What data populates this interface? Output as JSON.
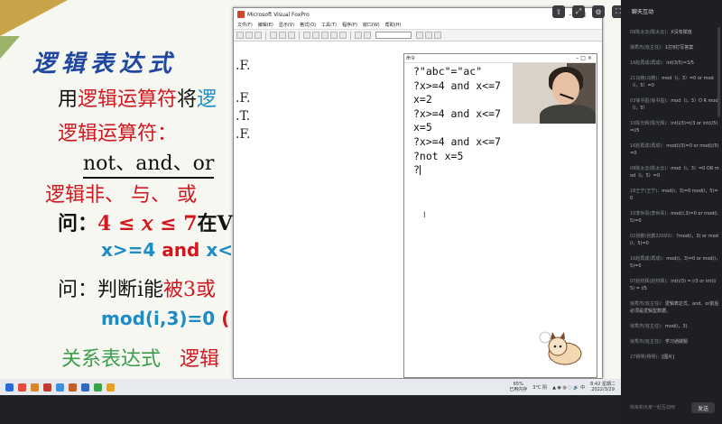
{
  "slide": {
    "title": "逻辑表达式",
    "line1_a": "用",
    "line1_b": "逻辑运算符",
    "line1_c": "将",
    "line1_d": "逻",
    "line2": "逻辑运算符：",
    "line3": "not、and、or",
    "line4": "逻辑非、 与、 或",
    "line5_a": "问：",
    "line5_b": "4 ≤ 𝑥 ≤ 7",
    "line5_c": "在V",
    "line6_a": "x>=4 ",
    "line6_b": "and",
    "line6_c": " x<",
    "line7_a": "问：判断i能",
    "line7_b": "被3或",
    "line8_a": "mod(i,3)=0",
    "line8_b": "  (",
    "line9_a": "关系表达式",
    "line9_b": "逻辑"
  },
  "vfp": {
    "title": "Microsoft Visual FoxPro",
    "menu": [
      "文件(F)",
      "编辑(E)",
      "显示(V)",
      "格式(O)",
      "工具(T)",
      "程序(P)",
      "窗口(W)",
      "帮助(H)"
    ],
    "bg_results": [
      ".F.",
      ".F.",
      ".T.",
      ".F."
    ],
    "command_window_title": "命令",
    "command_lines": [
      "?\"abc\"=\"ac\"",
      "?x>=4 and x<=7",
      "x=2",
      "?x>=4 and x<=7",
      "x=5",
      "?x>=4 and x<=7",
      "?not x=5",
      "?"
    ]
  },
  "taskbar": {
    "battery": "65%",
    "battery_sub": "已用内存",
    "weather": "3°C 阴",
    "time": "8:42 星期二",
    "date": "2022/3/29"
  },
  "chat": {
    "title": "聊天互动",
    "messages": [
      {
        "user": "09陈太云(陈太云)：",
        "text": "X没有赋值"
      },
      {
        "user": "徐秀杰(班主任)：",
        "text": "1打8打写答案"
      },
      {
        "user": "16赵再成(再成)：",
        "text": "int(3/5)=3/5"
      },
      {
        "user": "21马韩(马韩)：",
        "text": "mod（i，3）=0 or mod（i，5）=0"
      },
      {
        "user": "03徐书盈(徐书盈)：",
        "text": "mod（i，3）O R mod（i，5）"
      },
      {
        "user": "10陈光辉(陈光辉)：",
        "text": "int(i/3)=i/3 or int(i/5)=i/5"
      },
      {
        "user": "16赵再成(再成)：",
        "text": "mod(i/3)=0 or mod(i/5)=0"
      },
      {
        "user": "09陈太云(陈太云)：",
        "text": "mod（i，3）=0 OR mod（i，5）=0"
      },
      {
        "user": "18王宁(王宁)：",
        "text": "mod(i，3)=0 mod(i，5)=0"
      },
      {
        "user": "10李世青(李世青)：",
        "text": "mod(i,3)=0 or mod(i,5)=0"
      },
      {
        "user": "02张鹏(张鹏22093)：",
        "text": "?mod(i，3) or mod(i，5)=0"
      },
      {
        "user": "16赵再成(再成)：",
        "text": "mod(i，3)=0 or mod(i，5)=0"
      },
      {
        "user": "07赵钧辉(赵钧辉)：",
        "text": "int(i/3) = i/3 or int(i/5) = i/5"
      },
      {
        "user": "徐秀杰(班主任)：",
        "text": "逻辑表达式、and、or前后必须是逻辑型数据。"
      },
      {
        "user": "徐秀杰(班主任)：",
        "text": "mod(i，3)"
      },
      {
        "user": "徐秀杰(班主任)：",
        "text": "学习通做题"
      },
      {
        "user": "27杨明(杨明)：",
        "text": "[图片]"
      }
    ],
    "input_placeholder": "快来和大家一起互动吧",
    "send_label": "发送"
  },
  "colors": {
    "slide_red": "#d2161e",
    "slide_blue": "#1d8bc4",
    "slide_green": "#3a9e4c",
    "chat_bg": "#1e1f22"
  }
}
